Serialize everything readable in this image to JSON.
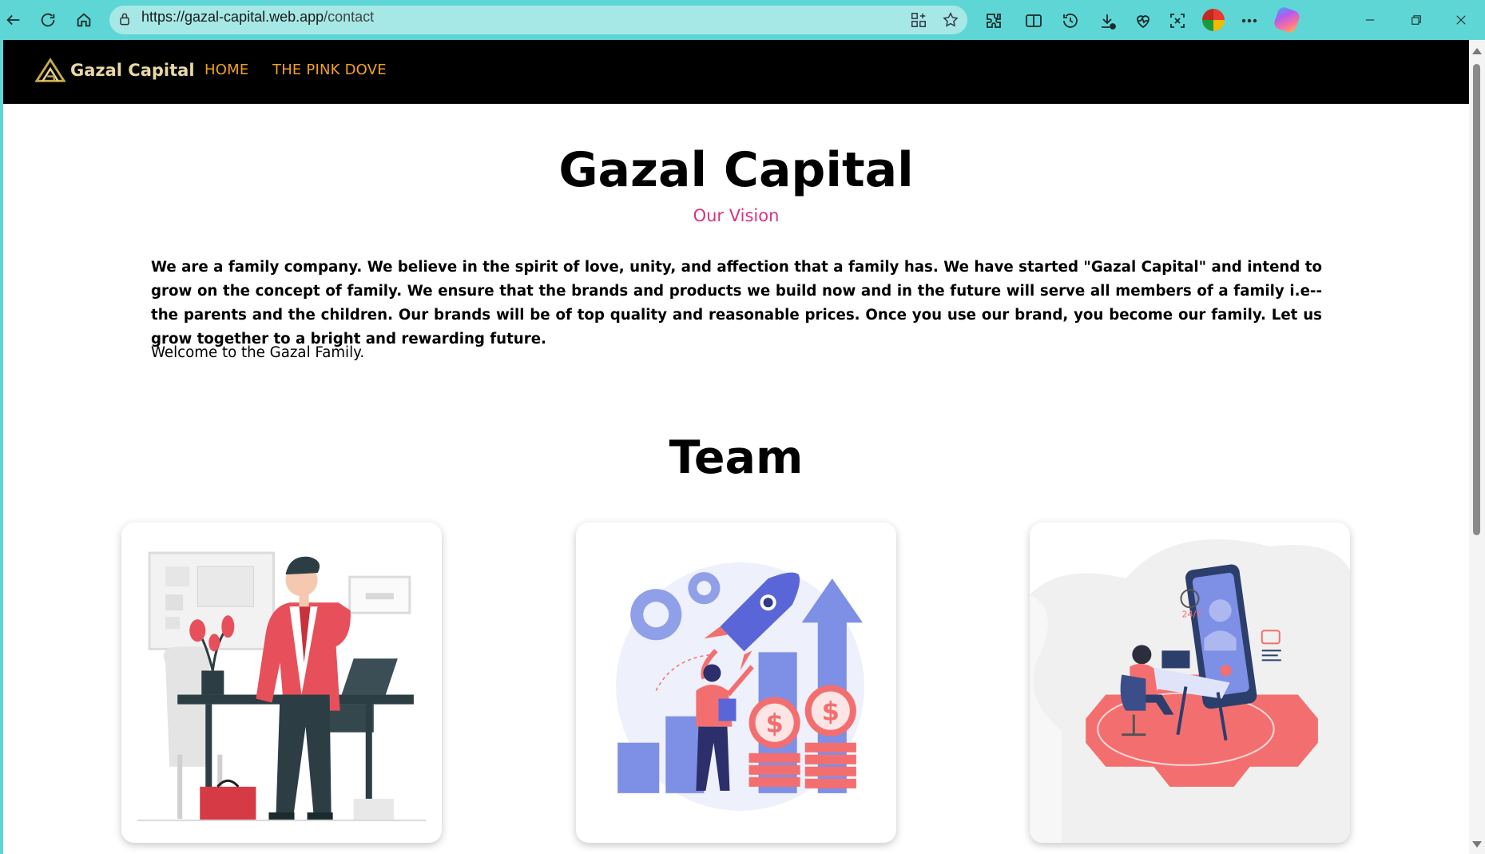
{
  "browser": {
    "url_domain": "https://gazal-capital.web.app",
    "url_path": "/contact"
  },
  "nav": {
    "brand": "Gazal Capital",
    "links": [
      "HOME",
      "THE PINK DOVE"
    ]
  },
  "hero": {
    "title": "Gazal Capital",
    "subtitle": "Our Vision"
  },
  "vision": {
    "text": "We are a family company. We believe in the spirit of love, unity, and affection that a family has. We have started \"Gazal Capital\" and intend to grow on the concept of family. We ensure that the brands and products we build now and in the future will serve all members of a family i.e-- the parents and the children. Our brands will be of top quality and reasonable prices. Once you use our brand, you become our family. Let us grow together to a bright and rewarding future.",
    "welcome": "Welcome to the Gazal Family."
  },
  "team": {
    "title": "Team",
    "cards": [
      {
        "illustration": "businessman-on-phone-at-desk"
      },
      {
        "illustration": "rocket-growth-chart-coins"
      },
      {
        "illustration": "customer-support-24-7-phone"
      }
    ]
  },
  "colors": {
    "browser_frame": "#5fd6d6",
    "navbar": "#000000",
    "nav_link": "#f3a21b",
    "brand": "#e8d8a8",
    "subtitle": "#d63384"
  }
}
